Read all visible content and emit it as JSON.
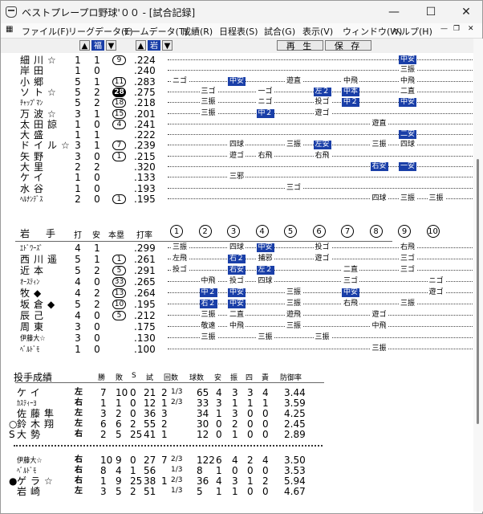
{
  "window": {
    "title": "ベストプレープロ野球'００ - [試合記録]"
  },
  "menu": [
    "ファイル(F)",
    "リーグデータ(L)",
    "チームデータ(T)",
    "成績(R)",
    "日程表(S)",
    "試合(G)",
    "表示(V)",
    "ウィンドウ(W)",
    "ヘルプ(H)"
  ],
  "toolbar": {
    "team1": "福",
    "team2": "岩",
    "replay": "再 生",
    "save": "保 存"
  },
  "team1_batters": [
    {
      "name": "細川☆",
      "ab": "1",
      "h": "1",
      "hr": "9",
      "avg": ".224",
      "res": [
        [
          9,
          "中安",
          1
        ]
      ]
    },
    {
      "name": "岸田",
      "ab": "1",
      "h": "0",
      "hr": "",
      "avg": ".240",
      "res": [
        [
          9,
          "三振",
          0
        ]
      ]
    },
    {
      "name": "小郷",
      "ab": "5",
      "h": "1",
      "hr": "11",
      "avg": ".283",
      "res": [
        [
          1,
          "ニゴ",
          0
        ],
        [
          3,
          "中安",
          1
        ],
        [
          5,
          "遊直",
          0
        ],
        [
          7,
          "中飛",
          0
        ],
        [
          9,
          "中飛",
          0
        ]
      ]
    },
    {
      "name": "ソト☆",
      "ab": "5",
      "h": "2",
      "hr": "28",
      "hrb": true,
      "avg": ".275",
      "res": [
        [
          2,
          "三ゴ",
          0
        ],
        [
          4,
          "一ゴ",
          0
        ],
        [
          6,
          "左２",
          1
        ],
        [
          7,
          "中本",
          1
        ],
        [
          9,
          "二直",
          0
        ]
      ]
    },
    {
      "name": "ﾁｬｯﾌﾟﾏﾝ",
      "sm": true,
      "ab": "5",
      "h": "2",
      "hr": "18",
      "avg": ".218",
      "res": [
        [
          2,
          "三振",
          0
        ],
        [
          4,
          "ニゴ",
          0
        ],
        [
          6,
          "投ゴ",
          0
        ],
        [
          7,
          "中２",
          1
        ],
        [
          9,
          "中安",
          1
        ]
      ]
    },
    {
      "name": "万波☆",
      "ab": "3",
      "h": "1",
      "hr": "15",
      "avg": ".201",
      "res": [
        [
          2,
          "三振",
          0
        ],
        [
          4,
          "中２",
          1
        ],
        [
          6,
          "遊ゴ",
          0
        ]
      ]
    },
    {
      "name": "太田諒",
      "ab": "1",
      "h": "0",
      "hr": "4",
      "avg": ".241",
      "res": [
        [
          8,
          "遊直",
          0
        ]
      ]
    },
    {
      "name": "大盛",
      "ab": "1",
      "h": "1",
      "hr": "",
      "avg": ".222",
      "res": [
        [
          9,
          "二安",
          1
        ]
      ]
    },
    {
      "name": "ドイル☆",
      "ab": "3",
      "h": "1",
      "hr": "7",
      "avg": ".239",
      "res": [
        [
          3,
          "四球",
          0
        ],
        [
          5,
          "三振",
          0
        ],
        [
          6,
          "左安",
          1
        ],
        [
          8,
          "三振",
          0
        ],
        [
          9,
          "四球",
          0
        ]
      ]
    },
    {
      "name": "矢野",
      "ab": "3",
      "h": "0",
      "hr": "1",
      "avg": ".215",
      "res": [
        [
          3,
          "遊ゴ",
          0
        ],
        [
          4,
          "右飛",
          0
        ],
        [
          6,
          "右飛",
          0
        ]
      ]
    },
    {
      "name": "大里",
      "ab": "2",
      "h": "2",
      "hr": "",
      "avg": ".320",
      "res": [
        [
          8,
          "右安",
          1
        ],
        [
          9,
          "一安",
          1
        ]
      ]
    },
    {
      "name": "ケイ",
      "ab": "1",
      "h": "0",
      "hr": "",
      "avg": ".133",
      "res": [
        [
          3,
          "三邪",
          0
        ]
      ]
    },
    {
      "name": "水谷",
      "ab": "1",
      "h": "0",
      "hr": "",
      "avg": ".193",
      "res": [
        [
          5,
          "三ゴ",
          0
        ]
      ]
    },
    {
      "name": "ﾍﾙﾅﾝﾃﾞｽ",
      "sm": true,
      "ab": "2",
      "h": "0",
      "hr": "1",
      "avg": ".195",
      "res": [
        [
          8,
          "四球",
          0
        ],
        [
          9,
          "三振",
          0
        ],
        [
          10,
          "三振",
          0
        ]
      ]
    }
  ],
  "team2_header": {
    "team": "岩　手",
    "ab": "打",
    "h": "安",
    "hr": "本塁",
    "avg": "打率",
    "innings": [
      "1",
      "2",
      "3",
      "4",
      "5",
      "6",
      "7",
      "8",
      "9",
      "10"
    ]
  },
  "team2_batters": [
    {
      "name": "ｴﾄﾞﾜｰｽﾞ",
      "sm": true,
      "ab": "4",
      "h": "1",
      "hr": "",
      "avg": ".299",
      "res": [
        [
          1,
          "三振",
          0
        ],
        [
          3,
          "四球",
          0
        ],
        [
          4,
          "中安",
          1
        ],
        [
          6,
          "投ゴ",
          0
        ],
        [
          9,
          "右飛",
          0
        ]
      ]
    },
    {
      "name": "西川遥",
      "ab": "5",
      "h": "1",
      "hr": "1",
      "avg": ".261",
      "res": [
        [
          1,
          "左飛",
          0
        ],
        [
          3,
          "右２",
          1
        ],
        [
          4,
          "捕邪",
          0
        ],
        [
          6,
          "遊ゴ",
          0
        ],
        [
          9,
          "三ゴ",
          0
        ]
      ]
    },
    {
      "name": "近本",
      "ab": "5",
      "h": "2",
      "hr": "5",
      "avg": ".291",
      "res": [
        [
          1,
          "投ゴ",
          0
        ],
        [
          3,
          "右安",
          1
        ],
        [
          4,
          "左２",
          1
        ],
        [
          7,
          "二直",
          0
        ],
        [
          9,
          "三ゴ",
          0
        ]
      ]
    },
    {
      "name": "ｵｰｽﾃｨﾝ",
      "sm": true,
      "ab": "4",
      "h": "0",
      "hr": "33",
      "avg": ".265",
      "res": [
        [
          2,
          "中飛",
          0
        ],
        [
          3,
          "投ゴ",
          0
        ],
        [
          4,
          "四球",
          0
        ],
        [
          7,
          "三ゴ",
          0
        ],
        [
          10,
          "ニゴ",
          0
        ]
      ]
    },
    {
      "name": "牧◆",
      "ab": "4",
      "h": "2",
      "hr": "13",
      "avg": ".264",
      "res": [
        [
          2,
          "中２",
          1
        ],
        [
          3,
          "中安",
          1
        ],
        [
          5,
          "三振",
          0
        ],
        [
          7,
          "中安",
          1
        ],
        [
          10,
          "遊ゴ",
          0
        ]
      ]
    },
    {
      "name": "坂倉◆",
      "ab": "5",
      "h": "2",
      "hr": "10",
      "avg": ".195",
      "res": [
        [
          2,
          "右２",
          1
        ],
        [
          3,
          "中安",
          1
        ],
        [
          5,
          "三振",
          0
        ],
        [
          7,
          "右飛",
          0
        ],
        [
          9,
          "三振",
          0
        ]
      ]
    },
    {
      "name": "辰己",
      "ab": "4",
      "h": "0",
      "hr": "5",
      "avg": ".212",
      "res": [
        [
          2,
          "三振",
          0
        ],
        [
          3,
          "二直",
          0
        ],
        [
          5,
          "遊飛",
          0
        ],
        [
          8,
          "遊ゴ",
          0
        ]
      ]
    },
    {
      "name": "周東",
      "ab": "3",
      "h": "0",
      "hr": "",
      "avg": ".175",
      "res": [
        [
          2,
          "敬遠",
          0
        ],
        [
          3,
          "中飛",
          0
        ],
        [
          5,
          "三振",
          0
        ],
        [
          8,
          "中飛",
          0
        ]
      ]
    },
    {
      "name": "伊藤大☆",
      "sm": true,
      "ab": "3",
      "h": "0",
      "hr": "",
      "avg": ".130",
      "res": [
        [
          2,
          "三振",
          0
        ],
        [
          4,
          "三振",
          0
        ],
        [
          6,
          "三振",
          0
        ]
      ]
    },
    {
      "name": "ﾍﾞﾙﾄﾞﾓ",
      "sm": true,
      "ab": "1",
      "h": "0",
      "hr": "",
      "avg": ".100",
      "res": [
        [
          8,
          "三振",
          0
        ]
      ]
    }
  ],
  "pitching": {
    "title": "投手成績",
    "headers": [
      "勝",
      "敗",
      "S",
      "試",
      "回数",
      "球数",
      "安",
      "振",
      "四",
      "責",
      "防御率"
    ],
    "group1": [
      {
        "mark": "",
        "name": "ケイ",
        "lr": "左",
        "w": "7",
        "l": "10",
        "s": "0",
        "g": "21",
        "ip": "2",
        "ipf": "1/3",
        "np": "65",
        "h": "4",
        "k": "3",
        "bb": "3",
        "er": "4",
        "era": "3.44"
      },
      {
        "mark": "",
        "name": "ｶｽﾃｨｰﾖ",
        "sm": true,
        "lr": "右",
        "w": "1",
        "l": "1",
        "s": "0",
        "g": "12",
        "ip": "1",
        "ipf": "2/3",
        "np": "33",
        "h": "3",
        "k": "1",
        "bb": "1",
        "er": "1",
        "era": "3.59"
      },
      {
        "mark": "",
        "name": "佐藤隼",
        "lr": "左",
        "w": "3",
        "l": "2",
        "s": "0",
        "g": "36",
        "ip": "3",
        "ipf": "",
        "np": "34",
        "h": "1",
        "k": "3",
        "bb": "0",
        "er": "0",
        "era": "4.25"
      },
      {
        "mark": "○",
        "name": "鈴木翔",
        "lr": "左",
        "w": "6",
        "l": "6",
        "s": "2",
        "g": "55",
        "ip": "2",
        "ipf": "",
        "np": "30",
        "h": "0",
        "k": "2",
        "bb": "0",
        "er": "0",
        "era": "2.45"
      },
      {
        "mark": "S",
        "name": "大勢",
        "lr": "右",
        "w": "2",
        "l": "5",
        "s": "25",
        "g": "41",
        "ip": "1",
        "ipf": "",
        "np": "12",
        "h": "0",
        "k": "1",
        "bb": "0",
        "er": "0",
        "era": "2.89"
      }
    ],
    "group2": [
      {
        "mark": "",
        "name": "伊藤大☆",
        "sm": true,
        "lr": "右",
        "w": "10",
        "l": "9",
        "s": "0",
        "g": "27",
        "ip": "7",
        "ipf": "2/3",
        "np": "122",
        "h": "6",
        "k": "4",
        "bb": "2",
        "er": "4",
        "era": "3.50"
      },
      {
        "mark": "",
        "name": "ﾍﾞﾙﾄﾞﾓ",
        "sm": true,
        "lr": "右",
        "w": "8",
        "l": "4",
        "s": "1",
        "g": "56",
        "ip": "",
        "ipf": "1/3",
        "np": "8",
        "h": "1",
        "k": "0",
        "bb": "0",
        "er": "0",
        "era": "3.53"
      },
      {
        "mark": "●",
        "name": "ゲラ☆",
        "lr": "右",
        "w": "1",
        "l": "9",
        "s": "25",
        "g": "38",
        "ip": "1",
        "ipf": "2/3",
        "np": "36",
        "h": "4",
        "k": "3",
        "bb": "1",
        "er": "2",
        "era": "5.94"
      },
      {
        "mark": "",
        "name": "岩崎",
        "lr": "左",
        "w": "3",
        "l": "5",
        "s": "2",
        "g": "51",
        "ip": "",
        "ipf": "1/3",
        "np": "5",
        "h": "1",
        "k": "1",
        "bb": "0",
        "er": "0",
        "era": "4.67"
      }
    ]
  }
}
